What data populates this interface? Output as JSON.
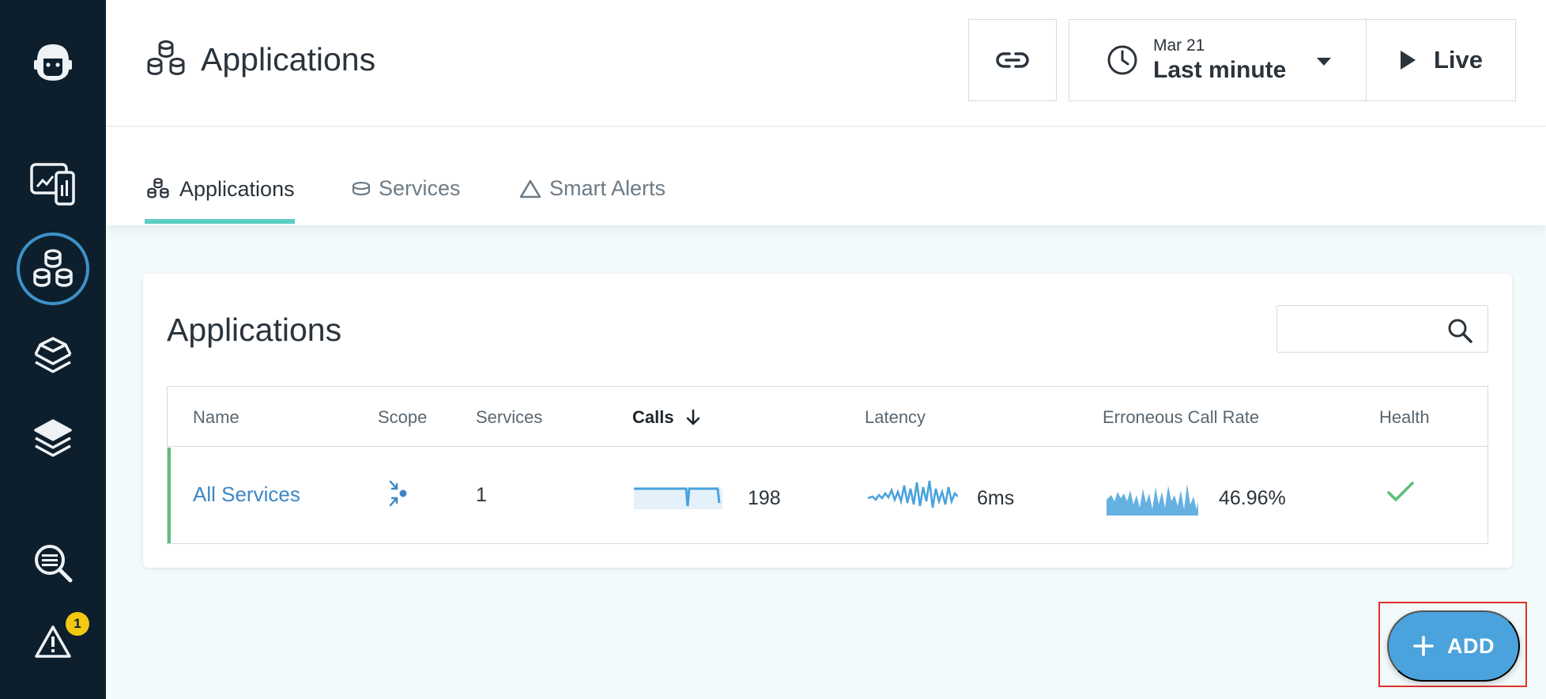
{
  "sidebar": {
    "items": [
      {
        "icon": "robot-logo-icon",
        "active": false
      },
      {
        "icon": "website-monitoring-icon",
        "active": false
      },
      {
        "icon": "applications-icon",
        "active": true
      },
      {
        "icon": "platforms-icon",
        "active": false
      },
      {
        "icon": "infrastructure-layers-icon",
        "active": false
      },
      {
        "icon": "analytics-search-icon",
        "active": false
      },
      {
        "icon": "events-alert-icon",
        "active": false,
        "badge": "1"
      }
    ]
  },
  "header": {
    "title": "Applications",
    "time": {
      "date": "Mar 21",
      "range": "Last minute"
    },
    "live_label": "Live"
  },
  "tabs": [
    {
      "label": "Applications",
      "icon": "applications-icon",
      "active": true
    },
    {
      "label": "Services",
      "icon": "services-icon",
      "active": false
    },
    {
      "label": "Smart Alerts",
      "icon": "smart-alerts-icon",
      "active": false
    }
  ],
  "card": {
    "title": "Applications",
    "search_placeholder": "",
    "columns": [
      "Name",
      "Scope",
      "Services",
      "Calls",
      "Latency",
      "Erroneous Call Rate",
      "Health"
    ],
    "sorted_column": "Calls",
    "rows": [
      {
        "name": "All Services",
        "scope_icon": "scope-inbound-icon",
        "services": "1",
        "calls": "198",
        "latency": "6ms",
        "error_rate": "46.96%",
        "health_icon": "check-icon"
      }
    ]
  },
  "add_button": {
    "label": "ADD"
  },
  "colors": {
    "sidebar_bg": "#0d1f2d",
    "accent_blue": "#4aa3dc",
    "tab_underline": "#5ccdc2",
    "healthy_green": "#5cbf78",
    "link_blue": "#3d86c6",
    "highlight_red": "#e0322a"
  }
}
